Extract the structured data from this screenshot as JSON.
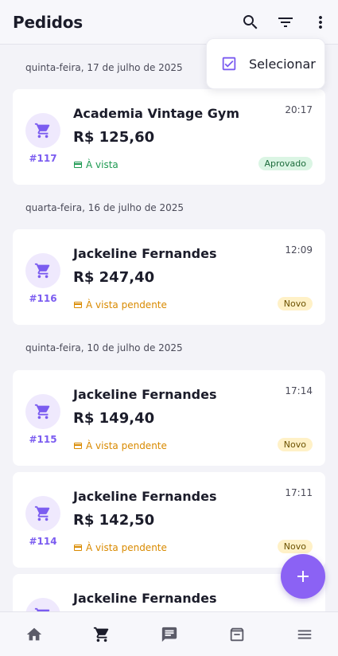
{
  "header": {
    "title": "Pedidos"
  },
  "menu": {
    "select_label": "Selecionar"
  },
  "dates": [
    "quinta-feira, 17 de julho de 2025",
    "quarta-feira, 16 de julho de 2025",
    "quinta-feira, 10 de julho de 2025"
  ],
  "orders": [
    {
      "number": "#117",
      "name": "Academia Vintage Gym",
      "time": "20:17",
      "amount": "R$ 125,60",
      "payment": "À vista",
      "status": "Aprovado"
    },
    {
      "number": "#116",
      "name": "Jackeline Fernandes",
      "time": "12:09",
      "amount": "R$ 247,40",
      "payment": "À vista pendente",
      "status": "Novo"
    },
    {
      "number": "#115",
      "name": "Jackeline Fernandes",
      "time": "17:14",
      "amount": "R$ 149,40",
      "payment": "À vista pendente",
      "status": "Novo"
    },
    {
      "number": "#114",
      "name": "Jackeline Fernandes",
      "time": "17:11",
      "amount": "R$ 142,50",
      "payment": "À vista pendente",
      "status": "Novo"
    },
    {
      "number": "",
      "name": "Jackeline Fernandes",
      "time": "",
      "amount": "",
      "payment": "",
      "status": ""
    }
  ],
  "colors": {
    "accent": "#7b5cf0",
    "approved": "#1e9a52",
    "pending": "#d98a00"
  },
  "nav": [
    "home-icon",
    "cart-icon",
    "chat-icon",
    "archive-icon",
    "menu-icon"
  ]
}
